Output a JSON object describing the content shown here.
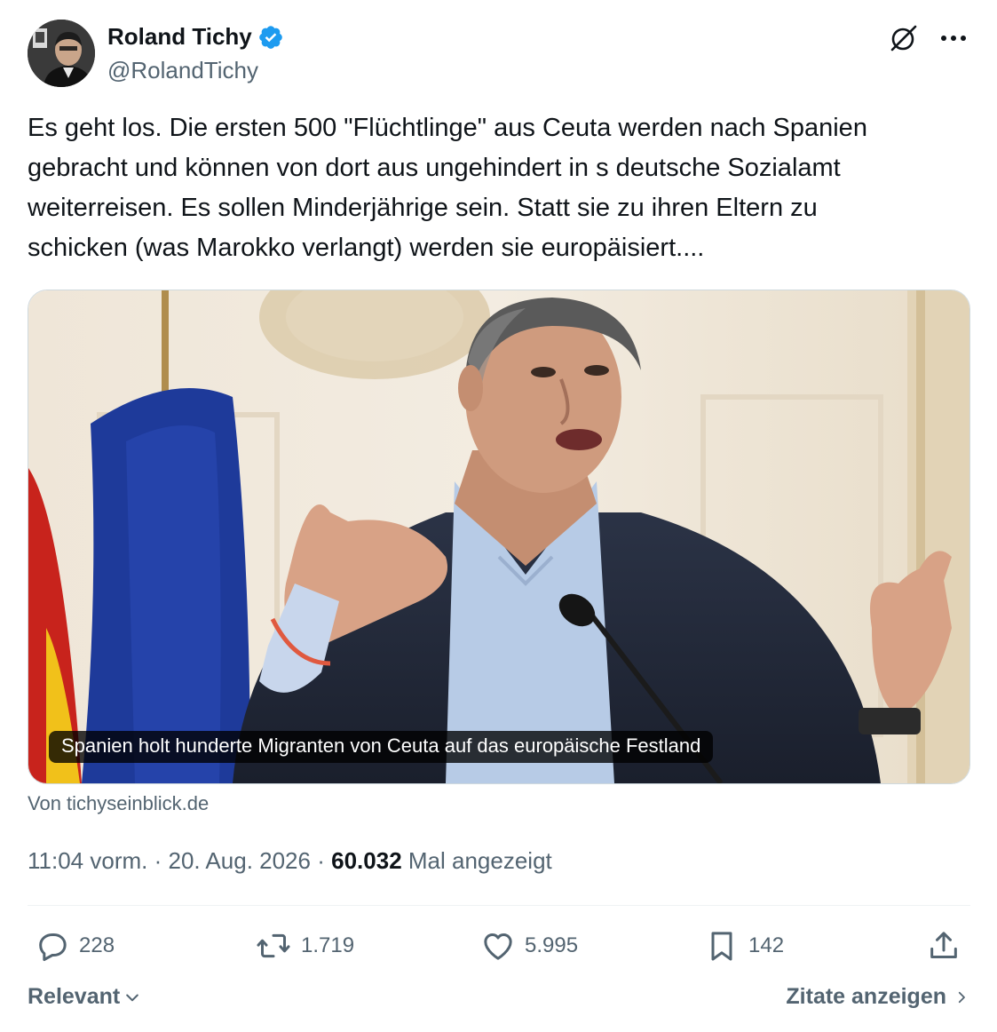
{
  "author": {
    "display_name": "Roland Tichy",
    "handle": "@RolandTichy",
    "verified": true,
    "verified_color": "#1d9bf0",
    "avatar_icon": "profile-photo"
  },
  "header_actions": {
    "grok_icon": "grok-icon",
    "more_icon": "more-horizontal-icon"
  },
  "tweet": {
    "text": "Es geht los. Die ersten 500 \"Flüchtlinge\" aus Ceuta werden nach Spanien\ngebracht und können von dort aus ungehindert in s deutsche Sozialamt\nweiterreisen. Es sollen Minderjährige sein. Statt sie zu ihren Eltern zu\nschicken (was Marokko verlangt) werden sie europäisiert...."
  },
  "media": {
    "caption": "Spanien holt hunderte Migranten von Ceuta auf das europäische Festland",
    "source": "Von tichyseinblick.de"
  },
  "meta": {
    "time": "11:04 vorm.",
    "separator": "·",
    "date": "20. Aug. 2026",
    "views_count": "60.032",
    "views_label": "Mal angezeigt"
  },
  "actions": {
    "replies": "228",
    "retweets": "1.719",
    "likes": "5.995",
    "bookmarks": "142"
  },
  "footer": {
    "sort_label": "Relevant",
    "quotes_label": "Zitate anzeigen"
  },
  "colors": {
    "text_primary": "#0f1419",
    "text_secondary": "#536471",
    "border": "#cfd9de",
    "accent": "#1d9bf0"
  }
}
